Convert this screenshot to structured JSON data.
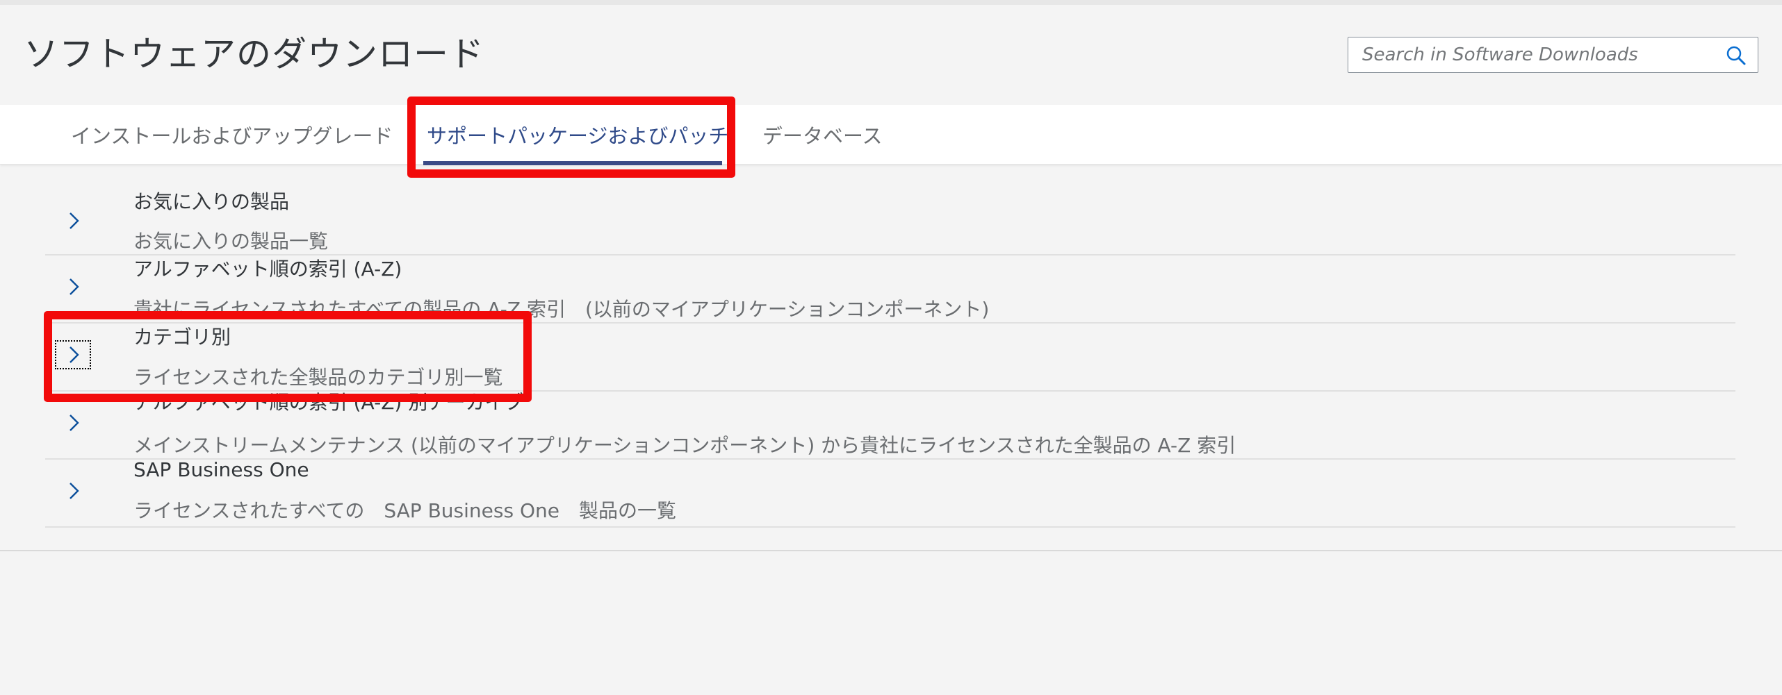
{
  "page": {
    "title": "ソフトウェアのダウンロード"
  },
  "search": {
    "placeholder": "Search in Software Downloads",
    "icon": "search-icon"
  },
  "tabs": [
    {
      "label": "インストールおよびアップグレード",
      "active": false
    },
    {
      "label": "サポートパッケージおよびパッチ",
      "active": true
    },
    {
      "label": "データベース",
      "active": false
    }
  ],
  "list": {
    "items": [
      {
        "title": "お気に入りの製品",
        "description": "お気に入りの製品一覧",
        "icon": "chevron-right-icon"
      },
      {
        "title": "アルファベット順の索引 (A-Z)",
        "description": "貴社にライセンスされたすべての製品の A-Z 索引　(以前のマイアプリケーションコンポーネント)",
        "icon": "chevron-right-icon"
      },
      {
        "title": "カテゴリ別",
        "description": "ライセンスされた全製品のカテゴリ別一覧",
        "icon": "chevron-right-icon"
      },
      {
        "title": "アルファベット順の索引 (A-Z) 別アーカイブ",
        "description": "メインストリームメンテナンス (以前のマイアプリケーションコンポーネント) から貴社にライセンスされた全製品の A-Z 索引",
        "icon": "chevron-right-icon"
      },
      {
        "title": "SAP Business One",
        "description": "ライセンスされたすべての　SAP Business One　製品の一覧",
        "icon": "chevron-right-icon"
      }
    ]
  },
  "colors": {
    "accent": "#2f4a89",
    "highlight": "#f20a0a",
    "background": "#f4f4f4"
  }
}
